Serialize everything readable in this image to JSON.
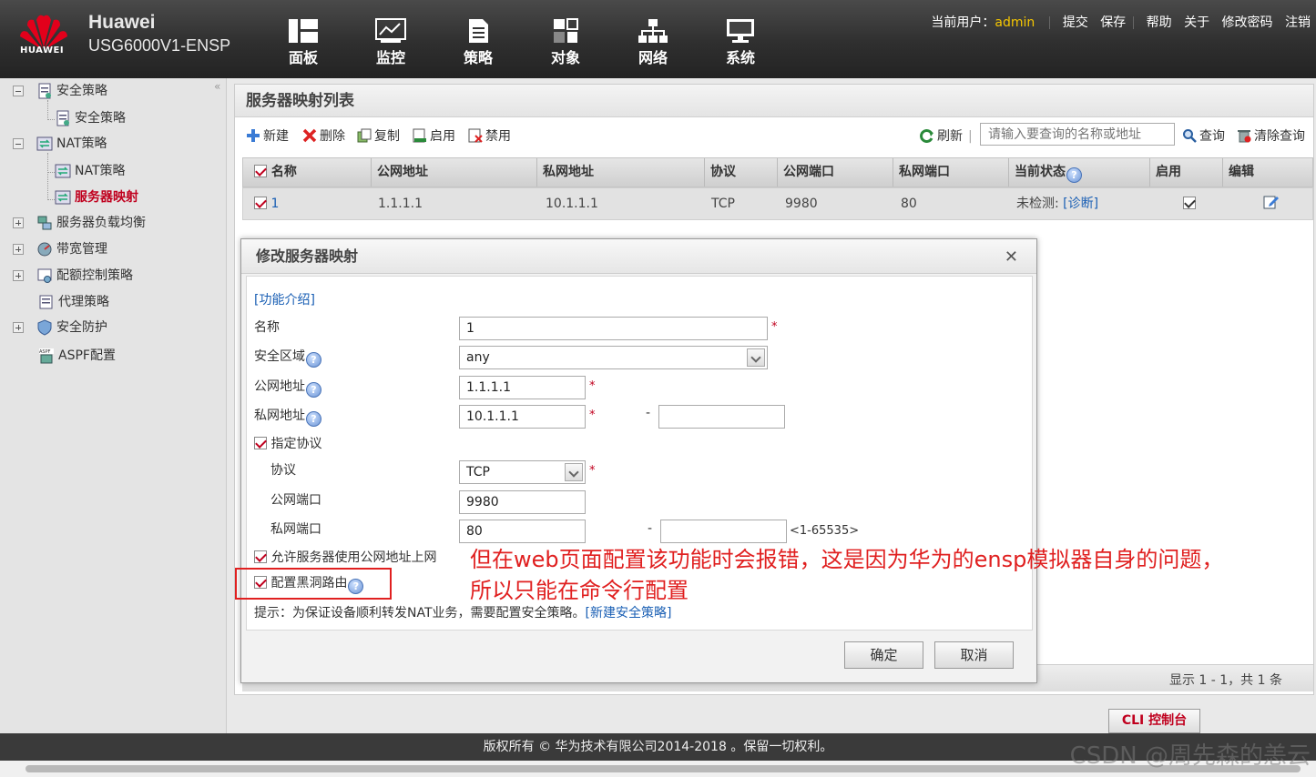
{
  "header": {
    "brand": "Huawei",
    "model": "USG6000V1-ENSP",
    "logo_text": "HUAWEI",
    "nav": [
      "面板",
      "监控",
      "策略",
      "对象",
      "网络",
      "系统"
    ],
    "user_label": "当前用户：",
    "user_name": "admin",
    "links": [
      "提交",
      "保存",
      "帮助",
      "关于",
      "修改密码",
      "注销"
    ]
  },
  "sidebar": {
    "items": [
      "安全策略",
      "安全策略",
      "NAT策略",
      "NAT策略",
      "服务器映射",
      "服务器负载均衡",
      "带宽管理",
      "配额控制策略",
      "代理策略",
      "安全防护",
      "ASPF配置"
    ]
  },
  "main": {
    "title": "服务器映射列表",
    "toolbar": [
      "新建",
      "删除",
      "复制",
      "启用",
      "禁用"
    ],
    "refresh": "刷新",
    "search_placeholder": "请输入要查询的名称或地址",
    "query": "查询",
    "clear": "清除查询",
    "columns": [
      "名称",
      "公网地址",
      "私网地址",
      "协议",
      "公网端口",
      "私网端口",
      "当前状态",
      "启用",
      "编辑"
    ],
    "row": {
      "name": "1",
      "public_ip": "1.1.1.1",
      "private_ip": "10.1.1.1",
      "protocol": "TCP",
      "public_port": "9980",
      "private_port": "80",
      "status": "未检测:",
      "diagnose": "[诊断]"
    },
    "pager": "显示 1 - 1，共 1 条"
  },
  "dialog": {
    "title": "修改服务器映射",
    "intro": "[功能介绍]",
    "name_label": "名称",
    "name_value": "1",
    "zone_label": "安全区域",
    "zone_value": "any",
    "public_label": "公网地址",
    "public_value": "1.1.1.1",
    "private_label": "私网地址",
    "private_value": "10.1.1.1",
    "dash": "-",
    "specify_protocol": "指定协议",
    "protocol_label": "协议",
    "protocol_value": "TCP",
    "public_port_label": "公网端口",
    "public_port_value": "9980",
    "private_port_label": "私网端口",
    "private_port_value": "80",
    "port_range": "<1-65535>",
    "allow_internet": "允许服务器使用公网地址上网",
    "blackhole": "配置黑洞路由",
    "tip": "提示：为保证设备顺利转发NAT业务，需要配置安全策略。",
    "tip_link": "[新建安全策略]",
    "ok": "确定",
    "cancel": "取消",
    "required": "*"
  },
  "annotation": {
    "line1": "但在web页面配置该功能时会报错，这是因为华为的ensp模拟器自身的问题，",
    "line2": "所以只能在命令行配置"
  },
  "cli_button": "CLI 控制台",
  "footer": "版权所有 © 华为技术有限公司2014-2018 。保留一切权利。",
  "watermark": "CSDN @周先森的恙云",
  "colors": {
    "accent": "#c0001e",
    "link": "#1a5fb4",
    "annotation": "#e02020",
    "user": "#f5c600"
  }
}
